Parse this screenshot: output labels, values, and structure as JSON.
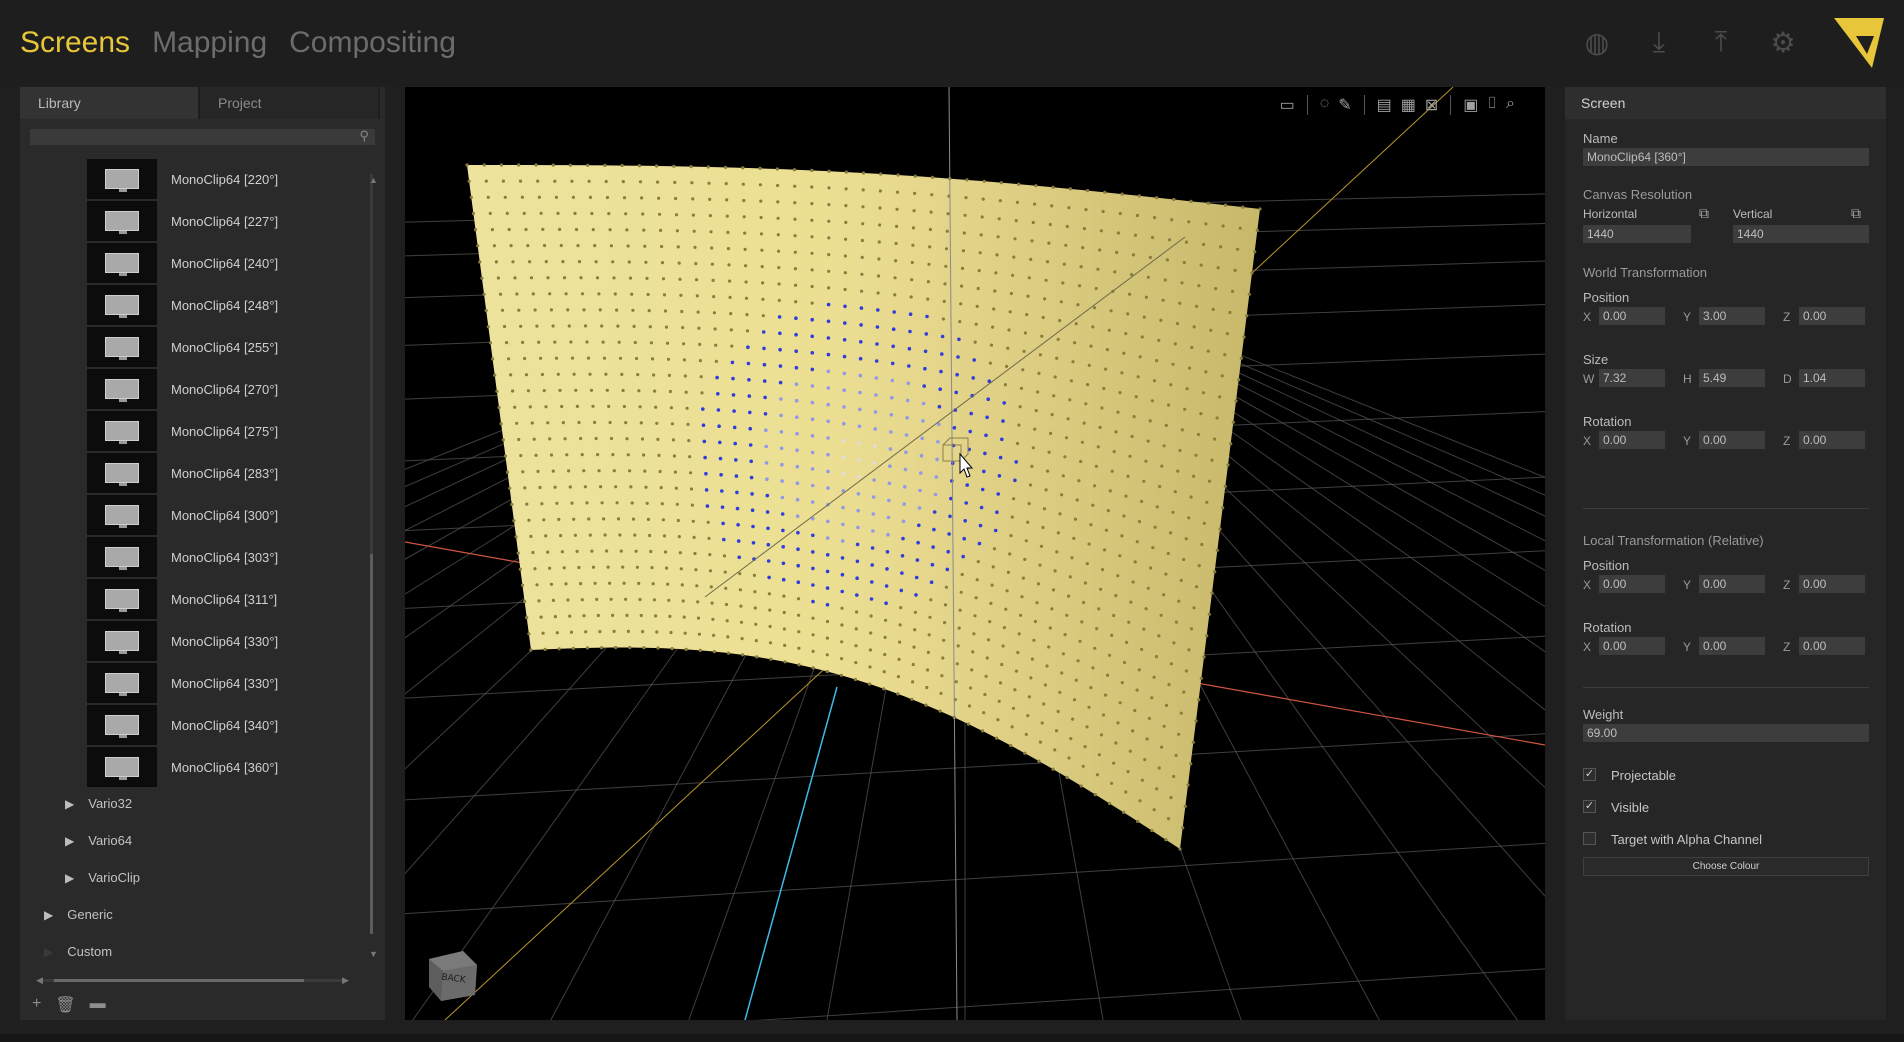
{
  "nav": {
    "tabs": [
      "Screens",
      "Mapping",
      "Compositing"
    ],
    "active": "Screens"
  },
  "accent": "#e8c63a",
  "top_icons": [
    "web-globe-icon",
    "download-icon",
    "upload-icon",
    "gear-icon"
  ],
  "library": {
    "tabs": {
      "library": "Library",
      "project": "Project"
    },
    "clips": [
      "MonoClip64 [220°]",
      "MonoClip64 [227°]",
      "MonoClip64 [240°]",
      "MonoClip64 [248°]",
      "MonoClip64 [255°]",
      "MonoClip64 [270°]",
      "MonoClip64 [275°]",
      "MonoClip64 [283°]",
      "MonoClip64 [300°]",
      "MonoClip64 [303°]",
      "MonoClip64 [311°]",
      "MonoClip64 [330°]",
      "MonoClip64 [330°]",
      "MonoClip64 [340°]",
      "MonoClip64 [360°]"
    ],
    "groups": [
      "Vario32",
      "Vario64",
      "VarioClip"
    ],
    "categories": [
      "Generic",
      "Custom"
    ]
  },
  "viewport": {
    "cube_label": "BACK"
  },
  "screen": {
    "title": "Screen",
    "name_label": "Name",
    "name": "MonoClip64 [360°]",
    "canvas_resolution": "Canvas Resolution",
    "horizontal_label": "Horizontal",
    "vertical_label": "Vertical",
    "horizontal": "1440",
    "vertical": "1440",
    "world_transformation": "World Transformation",
    "position_label": "Position",
    "size_label": "Size",
    "rotation_label": "Rotation",
    "world_position": {
      "x": "0.00",
      "y": "3.00",
      "z": "0.00"
    },
    "size": {
      "w": "7.32",
      "h": "5.49",
      "d": "1.04"
    },
    "world_rotation": {
      "x": "0.00",
      "y": "0.00",
      "z": "0.00"
    },
    "local_transformation": "Local Transformation (Relative)",
    "local_position": {
      "x": "0.00",
      "y": "0.00",
      "z": "0.00"
    },
    "local_rotation": {
      "x": "0.00",
      "y": "0.00",
      "z": "0.00"
    },
    "weight_label": "Weight",
    "weight": "69.00",
    "projectable": "Projectable",
    "visible": "Visible",
    "target_alpha": "Target with Alpha Channel",
    "choose_colour": "Choose Colour"
  }
}
